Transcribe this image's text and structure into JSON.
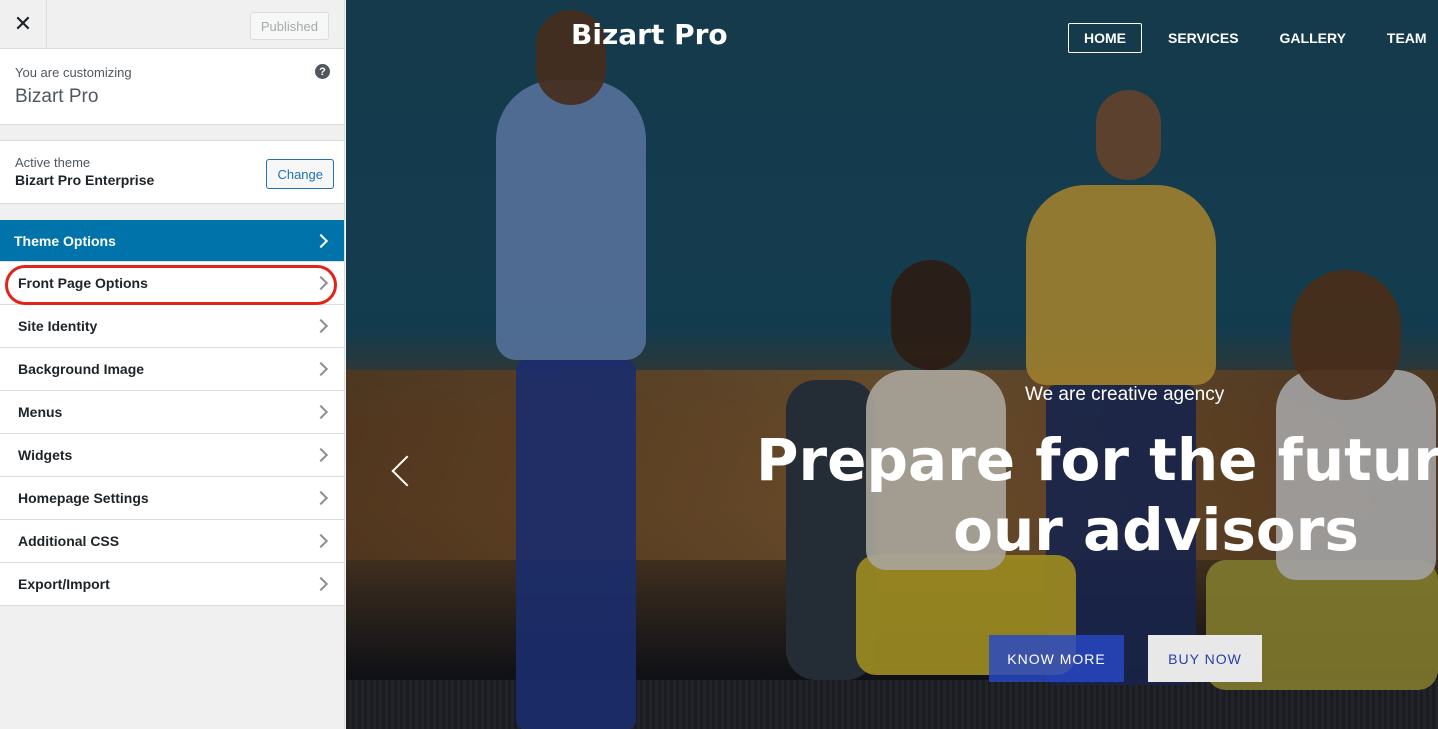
{
  "sidebar": {
    "close_icon": "close-icon",
    "published_label": "Published",
    "customizing": {
      "label": "You are customizing",
      "site_name": "Bizart Pro",
      "help_icon": "?"
    },
    "active_theme": {
      "label": "Active theme",
      "name": "Bizart Pro Enterprise",
      "change_label": "Change"
    },
    "menu": [
      {
        "label": "Theme Options",
        "active": true
      },
      {
        "label": "Front Page Options",
        "highlighted": true
      },
      {
        "label": "Site Identity"
      },
      {
        "label": "Background Image"
      },
      {
        "label": "Menus"
      },
      {
        "label": "Widgets"
      },
      {
        "label": "Homepage Settings"
      },
      {
        "label": "Additional CSS"
      },
      {
        "label": "Export/Import"
      }
    ],
    "highlight_color": "#e2231a",
    "active_color": "#0073aa"
  },
  "preview": {
    "brand": "Bizart Pro",
    "nav": [
      {
        "label": "HOME",
        "active": true
      },
      {
        "label": "SERVICES"
      },
      {
        "label": "GALLERY"
      },
      {
        "label": "TEAM"
      }
    ],
    "tagline": "We are creative agency",
    "headline_line1": "Prepare for the future wi",
    "headline_line2": "our advisors",
    "know_more_label": "KNOW MORE",
    "buy_now_label": "BUY NOW",
    "prev_icon": "chevron-left-icon",
    "know_more_color": "#2848c8"
  }
}
